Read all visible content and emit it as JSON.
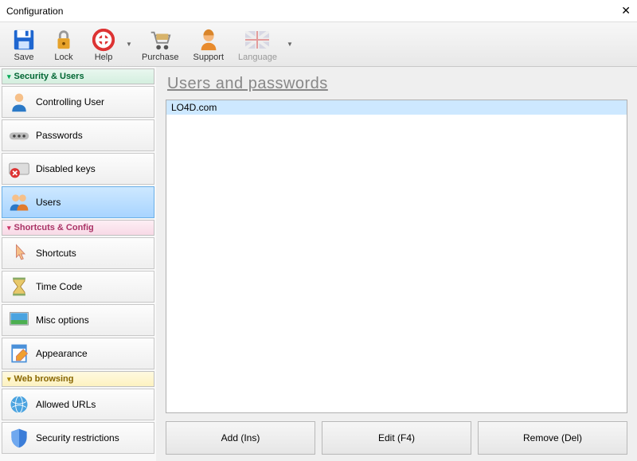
{
  "window": {
    "title": "Configuration"
  },
  "toolbar": {
    "save": "Save",
    "lock": "Lock",
    "help": "Help",
    "purchase": "Purchase",
    "support": "Support",
    "language": "Language"
  },
  "sidebar": {
    "section1": {
      "label": "Security & Users",
      "items": [
        {
          "label": "Controlling User"
        },
        {
          "label": "Passwords"
        },
        {
          "label": "Disabled keys"
        },
        {
          "label": "Users"
        }
      ]
    },
    "section2": {
      "label": "Shortcuts & Config",
      "items": [
        {
          "label": "Shortcuts"
        },
        {
          "label": "Time Code"
        },
        {
          "label": "Misc options"
        },
        {
          "label": "Appearance"
        }
      ]
    },
    "section3": {
      "label": "Web browsing",
      "items": [
        {
          "label": "Allowed URLs"
        },
        {
          "label": "Security restrictions"
        }
      ]
    }
  },
  "main": {
    "title": "Users and passwords",
    "list": [
      "LO4D.com"
    ],
    "buttons": {
      "add": "Add (Ins)",
      "edit": "Edit (F4)",
      "remove": "Remove (Del)"
    }
  }
}
